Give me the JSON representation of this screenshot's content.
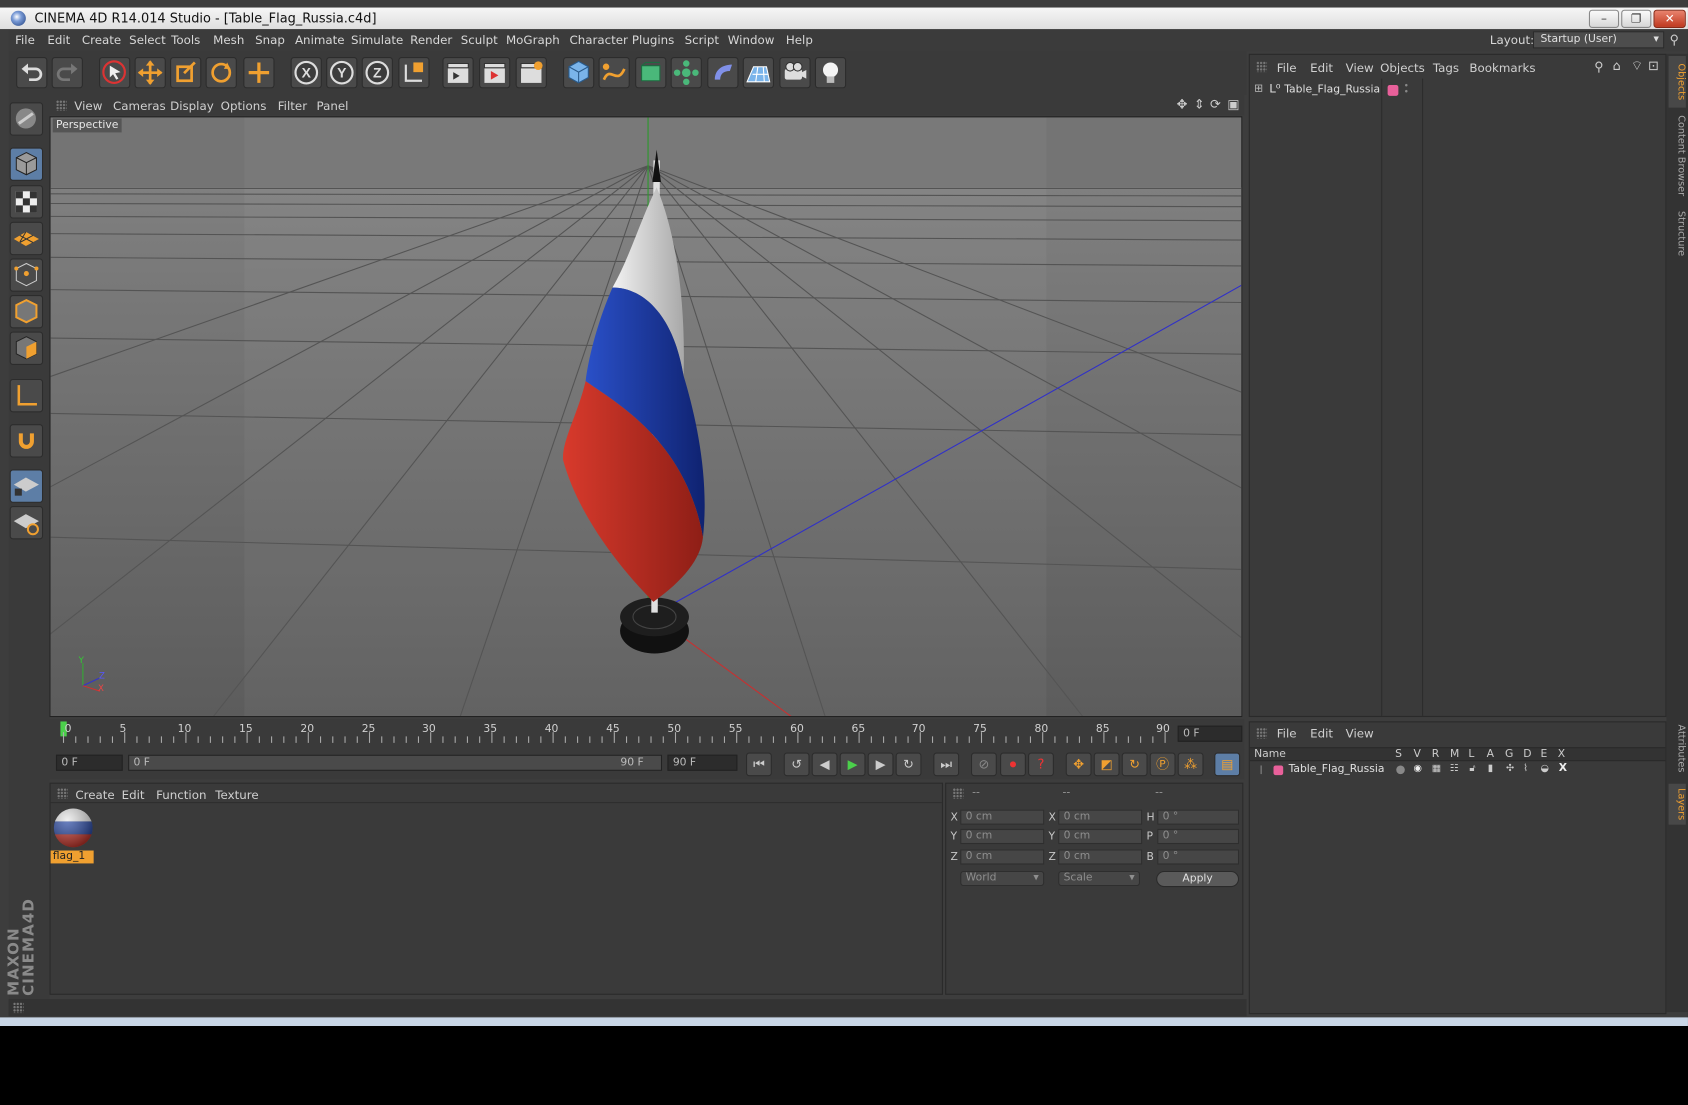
{
  "window": {
    "title": "CINEMA 4D R14.014 Studio - [Table_Flag_Russia.c4d]"
  },
  "menu": [
    "File",
    "Edit",
    "Create",
    "Select",
    "Tools",
    "Mesh",
    "Snap",
    "Animate",
    "Simulate",
    "Render",
    "Sculpt",
    "MoGraph",
    "Character",
    "Plugins",
    "Script",
    "Window",
    "Help"
  ],
  "layout": {
    "label": "Layout:",
    "value": "Startup (User)"
  },
  "viewport": {
    "menu": [
      "View",
      "Cameras",
      "Display",
      "Options",
      "Filter",
      "Panel"
    ],
    "label": "Perspective",
    "axes": {
      "y": "Y",
      "z": "Z",
      "x": "X"
    }
  },
  "timeline": {
    "ticks": [
      "0",
      "5",
      "10",
      "15",
      "20",
      "25",
      "30",
      "35",
      "40",
      "45",
      "50",
      "55",
      "60",
      "65",
      "70",
      "75",
      "80",
      "85",
      "90"
    ],
    "end_field": "0 F",
    "current_frame": "0 F",
    "range_start": "0 F",
    "range_end": "90 F",
    "max_frame": "90 F"
  },
  "material_panel": {
    "menu": [
      "Create",
      "Edit",
      "Function",
      "Texture"
    ],
    "materials": [
      {
        "name": "flag_1"
      }
    ]
  },
  "coordinates": {
    "headers": [
      "--",
      "--",
      "--"
    ],
    "rows": [
      {
        "l1": "X",
        "v1": "0 cm",
        "l2": "X",
        "v2": "0 cm",
        "l3": "H",
        "v3": "0 °"
      },
      {
        "l1": "Y",
        "v1": "0 cm",
        "l2": "Y",
        "v2": "0 cm",
        "l3": "P",
        "v3": "0 °"
      },
      {
        "l1": "Z",
        "v1": "0 cm",
        "l2": "Z",
        "v2": "0 cm",
        "l3": "B",
        "v3": "0 °"
      }
    ],
    "world": "World",
    "scale": "Scale",
    "apply": "Apply"
  },
  "objects_panel": {
    "menu": [
      "File",
      "Edit",
      "View",
      "Objects",
      "Tags",
      "Bookmarks"
    ],
    "items": [
      {
        "name": "Table_Flag_Russia",
        "color": "#e8609a"
      }
    ]
  },
  "layers_panel": {
    "menu": [
      "File",
      "Edit",
      "View"
    ],
    "columns": [
      "Name",
      "S",
      "V",
      "R",
      "M",
      "L",
      "A",
      "G",
      "D",
      "E",
      "X"
    ],
    "items": [
      {
        "name": "Table_Flag_Russia",
        "color": "#e8609a"
      }
    ]
  },
  "side_tabs": [
    "Objects",
    "Content Browser",
    "Structure",
    "Attributes",
    "Layers"
  ],
  "brand": "MAXON CINEMA4D",
  "colors": {
    "accent": "#f0a030",
    "flag_white": "#e6e6e6",
    "flag_blue": "#1d3fa0",
    "flag_red": "#c42a1f"
  }
}
